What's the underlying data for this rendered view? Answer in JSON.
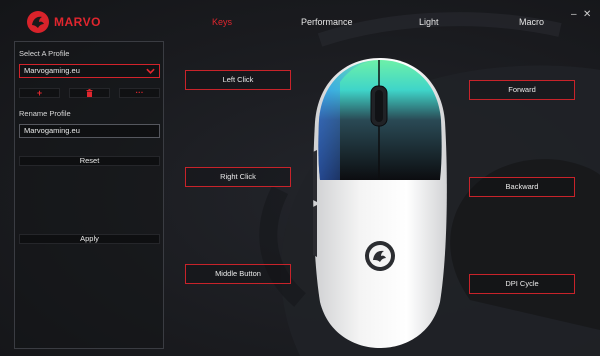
{
  "app": {
    "logo_text": "MARVO",
    "accent": "#d9232b",
    "background": "#1b1c20"
  },
  "nav": {
    "tabs": [
      {
        "label": "Keys",
        "active": true
      },
      {
        "label": "Performance",
        "active": false
      },
      {
        "label": "Light",
        "active": false
      },
      {
        "label": "Macro",
        "active": false
      }
    ]
  },
  "window_controls": {
    "minimize": "–",
    "close": "✕"
  },
  "profile_panel": {
    "select_label": "Select A Profile",
    "selected_profile": "Marvogaming.eu",
    "actions": [
      {
        "icon": "plus-icon",
        "glyph": "+"
      },
      {
        "icon": "trash-icon",
        "glyph": "🗑"
      },
      {
        "icon": "more-icon",
        "glyph": "···"
      }
    ],
    "rename_label": "Rename Profile",
    "rename_value": "Marvogaming.eu",
    "reset_label": "Reset",
    "apply_label": "Apply"
  },
  "key_assignments": {
    "left_click": "Left Click",
    "right_click": "Right Click",
    "middle_button": "Middle Button",
    "forward": "Forward",
    "backward": "Backward",
    "dpi_cycle": "DPI Cycle"
  }
}
